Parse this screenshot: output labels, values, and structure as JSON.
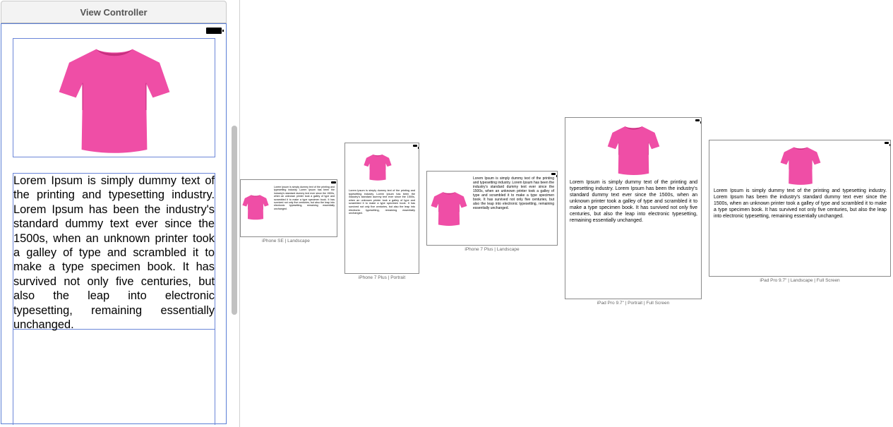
{
  "scene": {
    "title": "View Controller",
    "label_text": "Lorem Ipsum is simply dummy text of the printing and typesetting industry. Lorem Ipsum has been the industry's standard dummy text ever since the 1500s, when an unknown printer took a galley of type and scrambled it to make a type specimen book. It has survived not only five centuries, but also the leap into electronic typesetting, remaining essentially unchanged."
  },
  "colors": {
    "shirt": "#ef4ea6",
    "shirt_shade": "#d63a8f",
    "selection": "#6b86d8"
  },
  "previews": [
    {
      "caption": "iPhone SE | Landscape"
    },
    {
      "caption": "iPhone 7 Plus | Portrait"
    },
    {
      "caption": "iPhone 7 Plus | Landscape"
    },
    {
      "caption": "iPad Pro 9.7\" | Portrait | Full Screen"
    },
    {
      "caption": "iPad Pro 9.7\" | Landscape | Full Screen"
    }
  ]
}
